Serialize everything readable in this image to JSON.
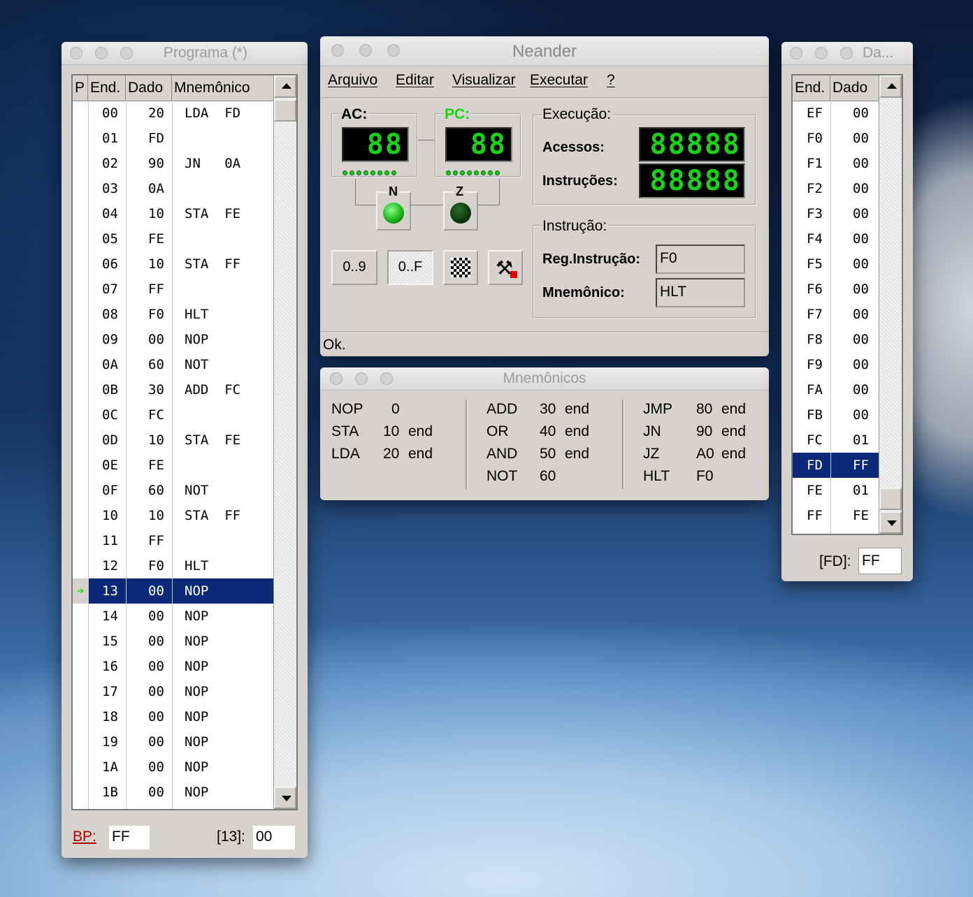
{
  "programa": {
    "title": "Programa  (*)",
    "columns": [
      "P",
      "End.",
      "Dado",
      "Mnemônico"
    ],
    "rows": [
      {
        "end": "00",
        "dado": "20",
        "mn": "LDA  FD"
      },
      {
        "end": "01",
        "dado": "FD",
        "mn": ""
      },
      {
        "end": "02",
        "dado": "90",
        "mn": "JN   0A"
      },
      {
        "end": "03",
        "dado": "0A",
        "mn": ""
      },
      {
        "end": "04",
        "dado": "10",
        "mn": "STA  FE"
      },
      {
        "end": "05",
        "dado": "FE",
        "mn": ""
      },
      {
        "end": "06",
        "dado": "10",
        "mn": "STA  FF"
      },
      {
        "end": "07",
        "dado": "FF",
        "mn": ""
      },
      {
        "end": "08",
        "dado": "F0",
        "mn": "HLT"
      },
      {
        "end": "09",
        "dado": "00",
        "mn": "NOP"
      },
      {
        "end": "0A",
        "dado": "60",
        "mn": "NOT"
      },
      {
        "end": "0B",
        "dado": "30",
        "mn": "ADD  FC"
      },
      {
        "end": "0C",
        "dado": "FC",
        "mn": ""
      },
      {
        "end": "0D",
        "dado": "10",
        "mn": "STA  FE"
      },
      {
        "end": "0E",
        "dado": "FE",
        "mn": ""
      },
      {
        "end": "0F",
        "dado": "60",
        "mn": "NOT"
      },
      {
        "end": "10",
        "dado": "10",
        "mn": "STA  FF"
      },
      {
        "end": "11",
        "dado": "FF",
        "mn": ""
      },
      {
        "end": "12",
        "dado": "F0",
        "mn": "HLT"
      },
      {
        "end": "13",
        "dado": "00",
        "mn": "NOP",
        "current": true
      },
      {
        "end": "14",
        "dado": "00",
        "mn": "NOP"
      },
      {
        "end": "15",
        "dado": "00",
        "mn": "NOP"
      },
      {
        "end": "16",
        "dado": "00",
        "mn": "NOP"
      },
      {
        "end": "17",
        "dado": "00",
        "mn": "NOP"
      },
      {
        "end": "18",
        "dado": "00",
        "mn": "NOP"
      },
      {
        "end": "19",
        "dado": "00",
        "mn": "NOP"
      },
      {
        "end": "1A",
        "dado": "00",
        "mn": "NOP"
      },
      {
        "end": "1B",
        "dado": "00",
        "mn": "NOP"
      }
    ],
    "bp_label": "BP:",
    "bp_value": "FF",
    "addr_label": "[13]:",
    "addr_value": "00"
  },
  "neander": {
    "title": "Neander",
    "menu": [
      "Arquivo",
      "Editar",
      "Visualizar",
      "Executar",
      "?"
    ],
    "ac_label": "AC:",
    "ac_value": "88",
    "pc_label": "PC:",
    "pc_value": "88",
    "n_label": "N",
    "z_label": "Z",
    "execucao_label": "Execução:",
    "acessos_label": "Acessos:",
    "acessos_value": "88888",
    "instrucoes_label": "Instruções:",
    "instrucoes_value": "88888",
    "btn_dec": "0..9",
    "btn_hex": "0..F",
    "instrucao_label": "Instrução:",
    "reg_instrucao_label": "Reg.Instrução:",
    "reg_instrucao_value": "F0",
    "mnemonico_label": "Mnemônico:",
    "mnemonico_value": "HLT",
    "status": "Ok.",
    "lcd_color": "#1bd21b"
  },
  "mnemonicos": {
    "title": "Mnemônicos",
    "col1": [
      [
        "NOP",
        "0",
        ""
      ],
      [
        "STA",
        "10",
        "end"
      ],
      [
        "LDA",
        "20",
        "end"
      ]
    ],
    "col2": [
      [
        "ADD",
        "30",
        "end"
      ],
      [
        "OR",
        "40",
        "end"
      ],
      [
        "AND",
        "50",
        "end"
      ],
      [
        "NOT",
        "60",
        ""
      ]
    ],
    "col3": [
      [
        "JMP",
        "80",
        "end"
      ],
      [
        "JN",
        "90",
        "end"
      ],
      [
        "JZ",
        "A0",
        "end"
      ],
      [
        "HLT",
        "F0",
        ""
      ]
    ]
  },
  "dados": {
    "title": "Da...",
    "columns": [
      "End.",
      "Dado"
    ],
    "rows": [
      {
        "end": "EF",
        "dado": "00"
      },
      {
        "end": "F0",
        "dado": "00"
      },
      {
        "end": "F1",
        "dado": "00"
      },
      {
        "end": "F2",
        "dado": "00"
      },
      {
        "end": "F3",
        "dado": "00"
      },
      {
        "end": "F4",
        "dado": "00"
      },
      {
        "end": "F5",
        "dado": "00"
      },
      {
        "end": "F6",
        "dado": "00"
      },
      {
        "end": "F7",
        "dado": "00"
      },
      {
        "end": "F8",
        "dado": "00"
      },
      {
        "end": "F9",
        "dado": "00"
      },
      {
        "end": "FA",
        "dado": "00"
      },
      {
        "end": "FB",
        "dado": "00"
      },
      {
        "end": "FC",
        "dado": "01"
      },
      {
        "end": "FD",
        "dado": "FF",
        "selected": true
      },
      {
        "end": "FE",
        "dado": "01"
      },
      {
        "end": "FF",
        "dado": "FE"
      }
    ],
    "addr_label": "[FD]:",
    "addr_value": "FF"
  },
  "colors": {
    "selection": "#0a2a78",
    "lcd_green": "#1bd21b",
    "bp_red": "#b00000"
  }
}
